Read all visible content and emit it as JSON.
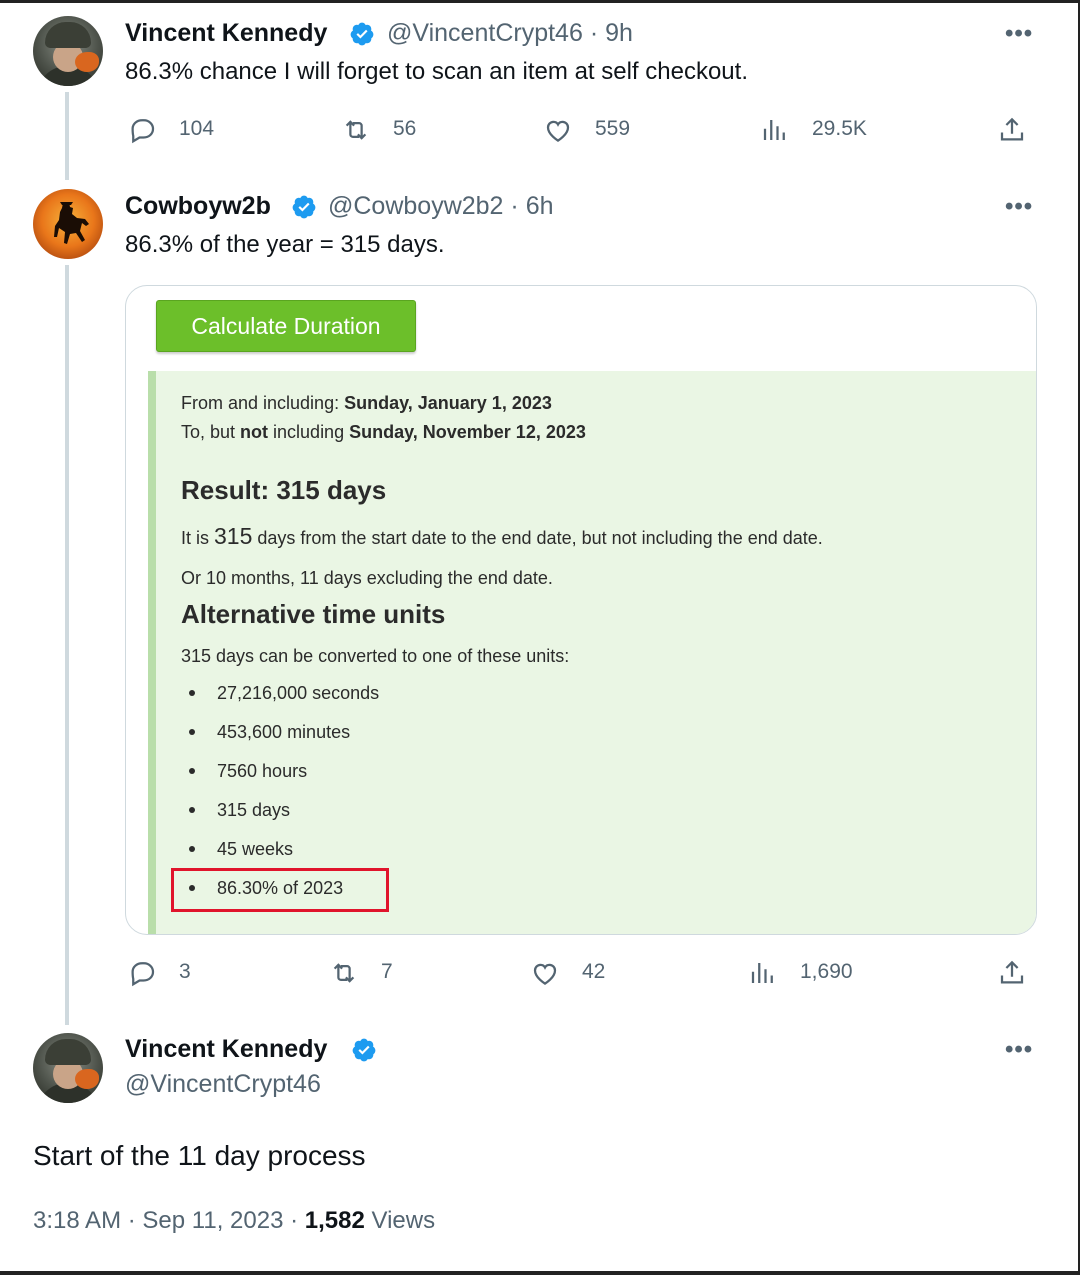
{
  "tweet1": {
    "name": "Vincent Kennedy",
    "handle": "@VincentCrypt46",
    "sep": "·",
    "time": "9h",
    "text": "86.3% chance I will forget to scan an item at self checkout.",
    "replies": "104",
    "retweets": "56",
    "likes": "559",
    "views": "29.5K"
  },
  "tweet2": {
    "name": "Cowboyw2b",
    "handle": "@Cowboyw2b2",
    "sep": "·",
    "time": "6h",
    "text": "86.3% of the year = 315 days.",
    "replies": "3",
    "retweets": "7",
    "likes": "42",
    "views": "1,690",
    "calculator": {
      "button_label": "Calculate Duration",
      "from_prefix": "From and including: ",
      "from_date": "Sunday, January 1, 2023",
      "to_prefix": "To, but ",
      "to_not": "not",
      "to_mid": " including ",
      "to_date": "Sunday, November 12, 2023",
      "result_heading": "Result: 315 days",
      "result_line_pre": "It is ",
      "result_line_num": "315",
      "result_line_post": " days from the start date to the end date, but not including the end date.",
      "alt_line": "Or 10 months, 11 days excluding the end date.",
      "alt_heading": "Alternative time units",
      "convert_line": "315 days can be converted to one of these units:",
      "units": [
        "27,216,000 seconds",
        "453,600 minutes",
        "7560 hours",
        "315 days",
        "45 weeks",
        "86.30% of 2023"
      ]
    }
  },
  "tweet3": {
    "name": "Vincent Kennedy",
    "handle": "@VincentCrypt46",
    "text": "Start of the 11 day process",
    "time": "3:18 AM",
    "sep": "·",
    "date": "Sep 11, 2023",
    "views_count": "1,582",
    "views_label": "Views"
  },
  "colors": {
    "verified_blue": "#1d9bf0",
    "button_green": "#6cbf2a",
    "result_bg": "#eaf6e4",
    "highlight_red": "#e0142b",
    "secondary_text": "#536471"
  },
  "icons": {
    "more": "•••"
  }
}
